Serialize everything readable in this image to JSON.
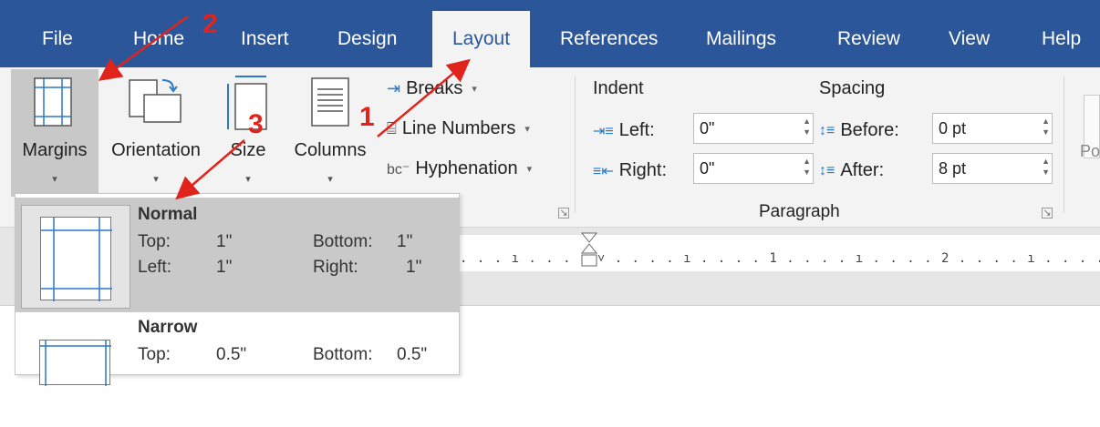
{
  "tabs": [
    "File",
    "Home",
    "Insert",
    "Design",
    "Layout",
    "References",
    "Mailings",
    "Review",
    "View",
    "Help"
  ],
  "active_tab": "Layout",
  "ribbon": {
    "margins": "Margins",
    "orientation": "Orientation",
    "size": "Size",
    "columns": "Columns",
    "breaks": "Breaks",
    "line_numbers": "Line Numbers",
    "hyphenation": "Hyphenation",
    "indent_title": "Indent",
    "spacing_title": "Spacing",
    "left_label": "Left:",
    "right_label": "Right:",
    "before_label": "Before:",
    "after_label": "After:",
    "left_value": "0\"",
    "right_value": "0\"",
    "before_value": "0 pt",
    "after_value": "8 pt",
    "paragraph_group": "Paragraph",
    "position_partial": "Po"
  },
  "ruler": {
    "marks": ". . . ı . . . . ˅ . . . . ı . . . . 1 . . . . ı . . . . 2 . . . . ı . . . . 3"
  },
  "margins_menu": [
    {
      "name": "Normal",
      "top_label": "Top:",
      "top": "1\"",
      "bottom_label": "Bottom:",
      "bottom": "1\"",
      "left_label": "Left:",
      "left": "1\"",
      "right_label": "Right:",
      "right": "1\""
    },
    {
      "name": "Narrow",
      "top_label": "Top:",
      "top": "0.5\"",
      "bottom_label": "Bottom:",
      "bottom": "0.5\""
    }
  ],
  "annotations": [
    "1",
    "2",
    "3"
  ],
  "colors": {
    "tab_bar": "#2b579a",
    "annotation": "#e0241b",
    "selected": "#c9c9c9"
  }
}
